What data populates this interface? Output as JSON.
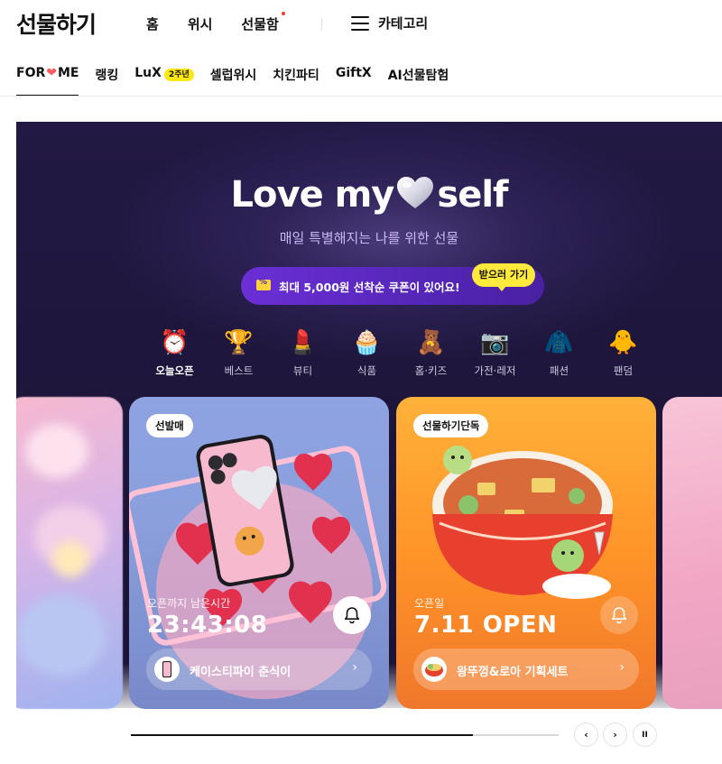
{
  "header": {
    "logo": "선물하기",
    "nav": [
      {
        "label": "홈"
      },
      {
        "label": "위시"
      },
      {
        "label": "선물함"
      }
    ],
    "category_label": "카테고리"
  },
  "tabs": [
    {
      "label_pre": "FOR",
      "label_heart": "❤",
      "label_post": "ME"
    },
    {
      "label": "랭킹"
    },
    {
      "label": "LuX",
      "badge": "2주년"
    },
    {
      "label": "셀럽위시"
    },
    {
      "label": "치킨파티"
    },
    {
      "label": "GiftX"
    },
    {
      "label": "AI선물탐험"
    }
  ],
  "hero": {
    "title_left": "Love my",
    "title_right": "self",
    "subtitle": "매일 특별해지는 나를 위한 선물",
    "coupon_text": "최대 5,000원 선착순 쿠폰이 있어요!",
    "coupon_cta": "받으러 가기",
    "categories": [
      {
        "label": "오늘오픈",
        "icon": "alarm-clock-icon",
        "glyph": "⏰"
      },
      {
        "label": "베스트",
        "icon": "trophy-icon",
        "glyph": "🏆"
      },
      {
        "label": "뷰티",
        "icon": "lipstick-icon",
        "glyph": "💄"
      },
      {
        "label": "식품",
        "icon": "cupcake-icon",
        "glyph": "🧁"
      },
      {
        "label": "홈·키즈",
        "icon": "teddy-bear-icon",
        "glyph": "🧸"
      },
      {
        "label": "가전·레저",
        "icon": "camera-icon",
        "glyph": "📷"
      },
      {
        "label": "패션",
        "icon": "sweater-icon",
        "glyph": "🧥"
      },
      {
        "label": "팬덤",
        "icon": "character-heart-icon",
        "glyph": "🐥"
      }
    ]
  },
  "cards": [
    {
      "chip": "선발매",
      "kicker": "오픈까지 남은시간",
      "big": "23:43:08",
      "product": "케이스티파이 춘식이",
      "chevron": "›"
    },
    {
      "chip": "선물하기단독",
      "kicker": "오픈일",
      "big": "7.11 OPEN",
      "product": "왕뚜껑&로아 기획세트",
      "chevron": "›"
    }
  ],
  "carousel": {
    "progress": 0.8,
    "prev": "‹",
    "next": "›",
    "pause": "II"
  },
  "colors": {
    "hero_bg": "#1d1539",
    "coupon_bg": "#5526b7",
    "cta_yellow": "#ffe93d",
    "badge_yellow": "#ffe812",
    "notify_dot": "#ff3b30"
  }
}
